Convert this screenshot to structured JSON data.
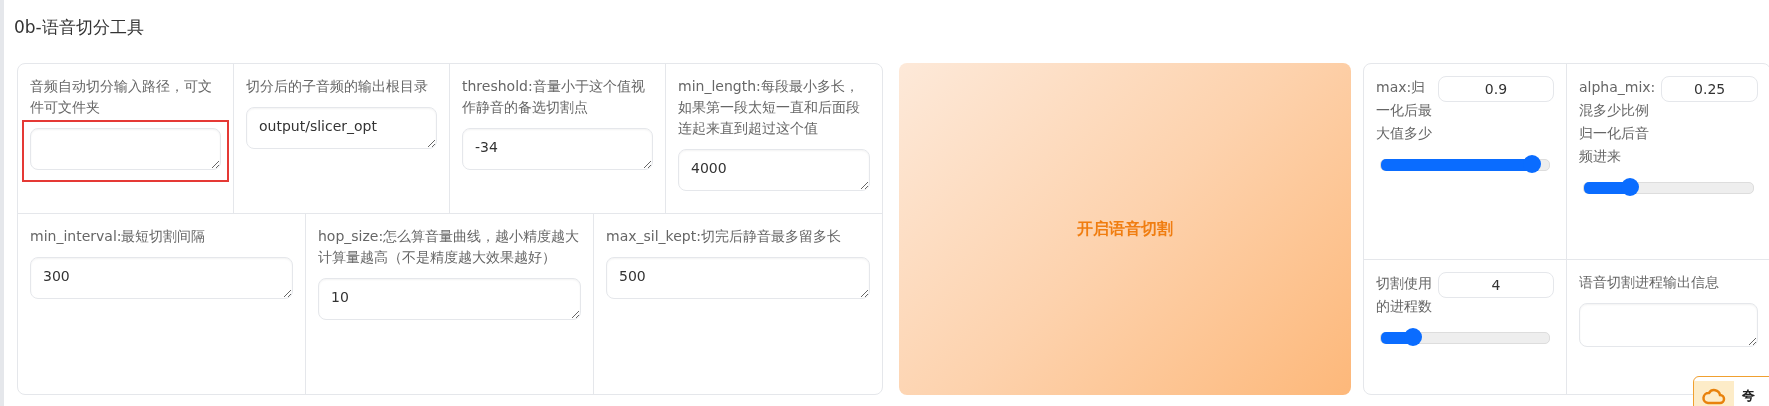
{
  "title": "0b-语音切分工具",
  "fields": [
    {
      "label": "音频自动切分输入路径，可文件可文件夹",
      "highlighted": true
    },
    {
      "label": "切分后的子音频的输出根目录",
      "value": "output/slicer_opt",
      "highlighted": false
    },
    {
      "label": "threshold:音量小于这个值视作静音的备选切割点",
      "value": "-34",
      "highlighted": false
    },
    {
      "label": "min_length:每段最小多长，如果第一段太短一直和后面段连起来直到超过这个值",
      "value": "4000",
      "highlighted": false
    },
    {
      "label": "min_interval:最短切割间隔",
      "value": "300",
      "highlighted": false
    },
    {
      "label": "hop_size:怎么算音量曲线，越小精度越大计算量越高（不是精度越大效果越好）",
      "value": "10",
      "highlighted": false
    },
    {
      "label": "max_sil_kept:切完后静音最多留多长",
      "value": "500",
      "highlighted": false
    }
  ],
  "start_button": {
    "label": "开启语音切割"
  },
  "settings": [
    {
      "kind": "slider",
      "label": "max:归一化后最大值多少",
      "value": "0.9",
      "level": 0.9
    },
    {
      "kind": "slider",
      "label": "alpha_mix:混多少比例归一化后音频进来",
      "value": "0.25",
      "level": 0.27
    },
    {
      "kind": "slider",
      "label": "切割使用的进程数",
      "value": "4",
      "level": 0.19
    },
    {
      "kind": "output",
      "label": "语音切割进程输出信息"
    }
  ],
  "overlay_badge": {
    "label": "夸"
  }
}
